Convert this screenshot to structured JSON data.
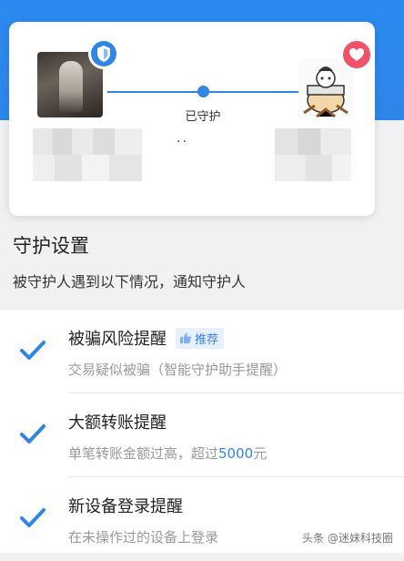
{
  "card": {
    "status_label": "已守护",
    "ellipsis": "··"
  },
  "settings": {
    "title": "守护设置",
    "subtitle": "被守护人遇到以下情况，通知守护人"
  },
  "items": [
    {
      "title": "被骗风险提醒",
      "badge": "推荐",
      "desc": "交易疑似被骗（智能守护助手提醒）",
      "checked": true
    },
    {
      "title": "大额转账提醒",
      "desc_prefix": "单笔转账金额过高，超过",
      "desc_amount": "5000",
      "desc_suffix": "元",
      "checked": true
    },
    {
      "title": "新设备登录提醒",
      "desc": "在未操作过的设备上登录",
      "checked": true
    }
  ],
  "watermark": "头条 @迷妹科技圈",
  "colors": {
    "accent": "#2f86e8",
    "heart": "#f0526a",
    "check": "#2f86e8"
  }
}
